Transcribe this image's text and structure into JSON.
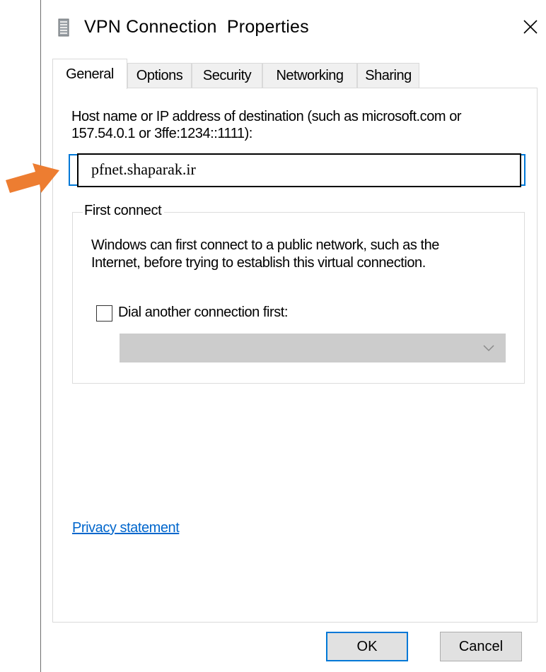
{
  "window": {
    "title": "VPN Connection  Properties"
  },
  "tabs": [
    "General",
    "Options",
    "Security",
    "Networking",
    "Sharing"
  ],
  "general": {
    "host_label_line1": "Host name or IP address of destination (such as microsoft.com or",
    "host_label_line2": "157.54.0.1 or 3ffe:1234::1111):",
    "host_value": "pfnet.shaparak.ir",
    "first_connect": {
      "legend": "First connect",
      "desc_line1": "Windows can first connect to a public network, such as the",
      "desc_line2": "Internet, before trying to establish this virtual connection.",
      "checkbox_label": "Dial another connection first:",
      "checkbox_checked": false,
      "dropdown_value": ""
    },
    "privacy_link": "Privacy statement"
  },
  "buttons": {
    "ok": "OK",
    "cancel": "Cancel"
  },
  "colors": {
    "accent": "#0078d7",
    "annotation_arrow": "#ed7d31",
    "link": "#0066cc"
  },
  "icons": {
    "app": "phone-book-icon",
    "close": "close-icon",
    "dropdown": "chevron-down-icon",
    "annotation": "arrow-right-icon"
  }
}
